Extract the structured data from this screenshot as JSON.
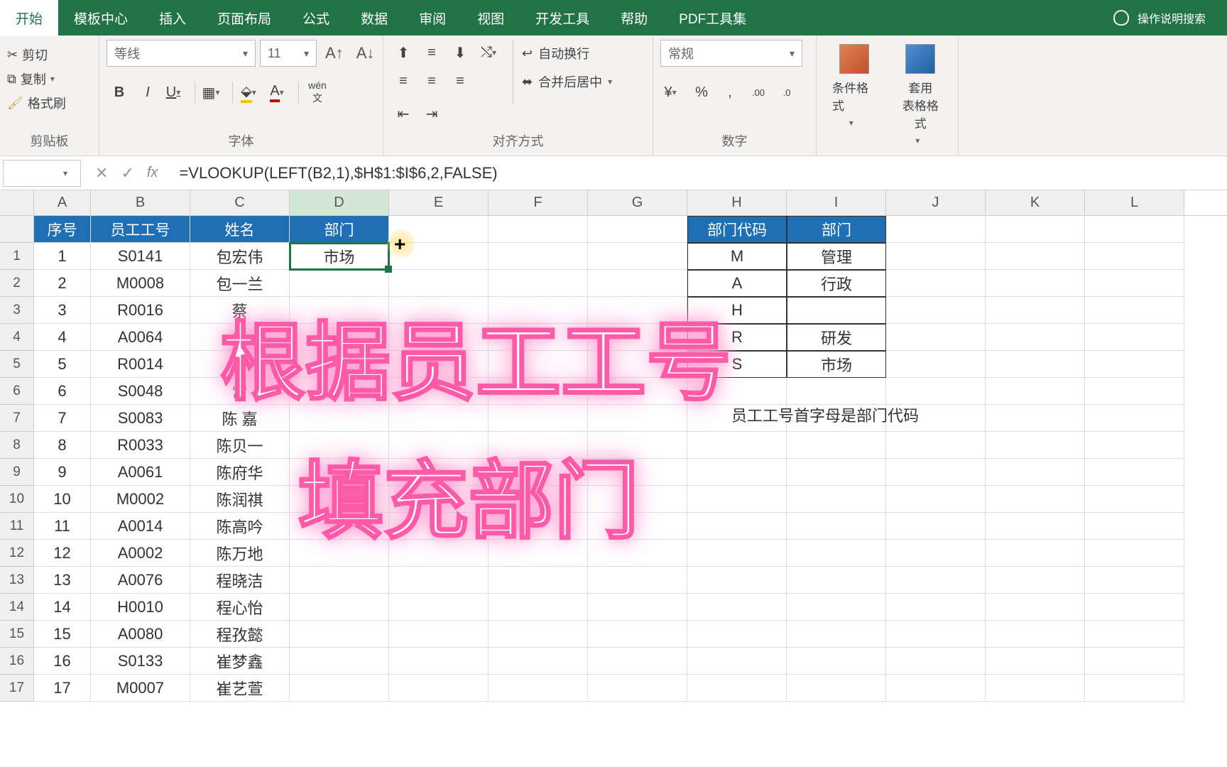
{
  "tabs": [
    "开始",
    "模板中心",
    "插入",
    "页面布局",
    "公式",
    "数据",
    "审阅",
    "视图",
    "开发工具",
    "帮助",
    "PDF工具集"
  ],
  "search_placeholder": "操作说明搜索",
  "clipboard": {
    "cut": "剪切",
    "copy": "复制",
    "paint": "格式刷",
    "label": "剪贴板"
  },
  "font": {
    "name": "等线",
    "size": "11",
    "wen": "wén",
    "label": "字体"
  },
  "align": {
    "wrap": "自动换行",
    "merge": "合并后居中",
    "label": "对齐方式"
  },
  "number": {
    "style": "常规",
    "label": "数字"
  },
  "styles": {
    "cond": "条件格式",
    "table": "套用\n表格格式"
  },
  "formula": "=VLOOKUP(LEFT(B2,1),$H$1:$I$6,2,FALSE)",
  "columns": [
    "A",
    "B",
    "C",
    "D",
    "E",
    "F",
    "G",
    "H",
    "I",
    "J",
    "K",
    "L"
  ],
  "headers": {
    "a": "序号",
    "b": "员工工号",
    "c": "姓名",
    "d": "部门",
    "h": "部门代码",
    "i": "部门"
  },
  "employees": [
    {
      "n": "1",
      "id": "S0141",
      "name": "包宏伟",
      "dept": "市场"
    },
    {
      "n": "2",
      "id": "M0008",
      "name": "包一兰",
      "dept": ""
    },
    {
      "n": "3",
      "id": "R0016",
      "name": "蔡",
      "dept": ""
    },
    {
      "n": "4",
      "id": "A0064",
      "name": "曾",
      "dept": ""
    },
    {
      "n": "5",
      "id": "R0014",
      "name": "曾",
      "dept": ""
    },
    {
      "n": "6",
      "id": "S0048",
      "name": "常",
      "dept": ""
    },
    {
      "n": "7",
      "id": "S0083",
      "name": "陈  嘉",
      "dept": ""
    },
    {
      "n": "8",
      "id": "R0033",
      "name": "陈贝一",
      "dept": ""
    },
    {
      "n": "9",
      "id": "A0061",
      "name": "陈府华",
      "dept": ""
    },
    {
      "n": "10",
      "id": "M0002",
      "name": "陈润祺",
      "dept": ""
    },
    {
      "n": "11",
      "id": "A0014",
      "name": "陈高吟",
      "dept": ""
    },
    {
      "n": "12",
      "id": "A0002",
      "name": "陈万地",
      "dept": ""
    },
    {
      "n": "13",
      "id": "A0076",
      "name": "程晓洁",
      "dept": ""
    },
    {
      "n": "14",
      "id": "H0010",
      "name": "程心怡",
      "dept": ""
    },
    {
      "n": "15",
      "id": "A0080",
      "name": "程孜懿",
      "dept": ""
    },
    {
      "n": "16",
      "id": "S0133",
      "name": "崔梦鑫",
      "dept": ""
    },
    {
      "n": "17",
      "id": "M0007",
      "name": "崔艺萱",
      "dept": ""
    }
  ],
  "lookup": [
    {
      "code": "M",
      "dept": "管理"
    },
    {
      "code": "A",
      "dept": "行政"
    },
    {
      "code": "H",
      "dept": ""
    },
    {
      "code": "R",
      "dept": "研发"
    },
    {
      "code": "S",
      "dept": "市场"
    }
  ],
  "note": "员工工号首字母是部门代码",
  "overlay1": "根据员工工号",
  "overlay2": "填充部门"
}
